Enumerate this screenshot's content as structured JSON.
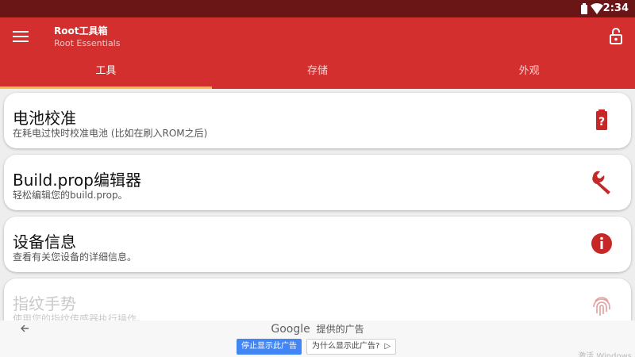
{
  "status_bar": {
    "time": "2:34",
    "icons": [
      "battery-icon",
      "wifi-icon"
    ]
  },
  "app_bar": {
    "title": "Root工具箱",
    "subtitle": "Root Essentials",
    "menu_icon": "hamburger-menu-icon",
    "lock_icon": "lock-open-icon"
  },
  "tabs": [
    {
      "label": "工具",
      "active": true
    },
    {
      "label": "存储",
      "active": false
    },
    {
      "label": "外观",
      "active": false
    }
  ],
  "cards": [
    {
      "title": "电池校准",
      "desc": "在耗电过快时校准电池 (比如在刷入ROM之后)",
      "icon": "battery-question-icon"
    },
    {
      "title": "Build.prop编辑器",
      "desc": "轻松编辑您的build.prop。",
      "icon": "wrench-icon"
    },
    {
      "title": "设备信息",
      "desc": "查看有关您设备的详细信息。",
      "icon": "info-icon"
    },
    {
      "title": "指纹手势",
      "desc": "使用您的指纹传感器执行操作。",
      "icon": "fingerprint-icon"
    }
  ],
  "ad": {
    "google": "Google",
    "label": "提供的广告",
    "stop_button": "停止显示此广告",
    "why_button": "为什么显示此广告?",
    "watermark": "激活 Windows"
  },
  "colors": {
    "primary": "#d32f2f",
    "status_bar": "#6b1616",
    "tab_indicator": "#ffb74d",
    "icon_red": "#c62828"
  }
}
